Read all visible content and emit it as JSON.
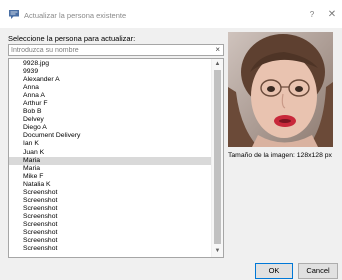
{
  "window": {
    "title": "Actualizar la persona existente",
    "help": "?",
    "close": "✕"
  },
  "prompt": "Seleccione la persona para actualizar:",
  "search": {
    "placeholder": "Introduzca su nombre",
    "value": "",
    "clear": "×"
  },
  "people": [
    "9928.jpg",
    "9939",
    "Alexander A",
    "Anna",
    "Anna A",
    "Arthur F",
    "Bob B",
    "Delvey",
    "Diego A",
    "Document Delivery",
    "Ian K",
    "Juan K",
    "Maria",
    "Maria",
    "Mike F",
    "Natalia K",
    "Screenshot",
    "Screenshot",
    "Screenshot",
    "Screenshot",
    "Screenshot",
    "Screenshot",
    "Screenshot",
    "Screenshot"
  ],
  "selected_index": 12,
  "image_size_label": "Tamaño de la imagen: 128x128 px",
  "buttons": {
    "ok": "OK",
    "cancel": "Cancel"
  },
  "colors": {
    "app_icon": "#4a6fa5",
    "selection": "#d9d9d9",
    "ok_border": "#0078d7"
  }
}
